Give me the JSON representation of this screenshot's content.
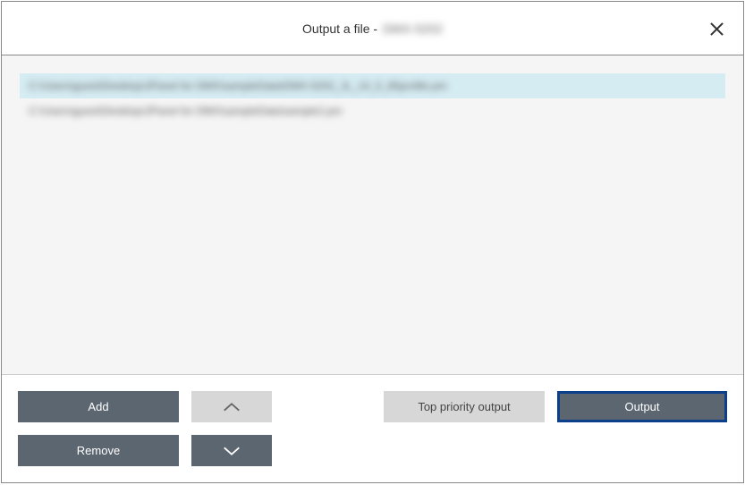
{
  "title": {
    "prefix": "Output a file -",
    "suffix": "DMX-5202"
  },
  "list": {
    "items": [
      {
        "path": "C:\\Users\\guest\\Desktop\\JPanel for DMX\\sampleData\\DMX-5202_JL_14_5_85profile.pm",
        "selected": true
      },
      {
        "path": "C:\\Users\\guest\\Desktop\\JPanel for DMX\\sampleData\\sample2.pm",
        "selected": false
      }
    ]
  },
  "buttons": {
    "add": "Add",
    "remove": "Remove",
    "top_priority": "Top priority output",
    "output": "Output"
  }
}
